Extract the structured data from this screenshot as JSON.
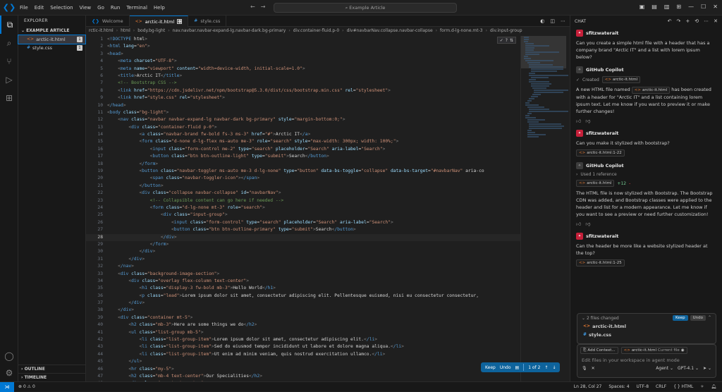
{
  "title": {
    "menu": [
      "File",
      "Edit",
      "Selection",
      "View",
      "Go",
      "Run",
      "Terminal",
      "Help"
    ],
    "search": "Example Article"
  },
  "explorer": {
    "header": "EXPLORER",
    "section": "EXAMPLE ARTICLE",
    "files": [
      {
        "name": "arctic-it.html",
        "badge": "1"
      },
      {
        "name": "style.css",
        "badge": "1"
      }
    ],
    "outline": "OUTLINE",
    "timeline": "TIMELINE"
  },
  "tabs": {
    "welcome": "Welcome",
    "arctic": "arctic-it.html",
    "style": "style.css"
  },
  "breadcrumb": [
    "rctic-it.html",
    "html",
    "body.bg-light",
    "nav.navbar.navbar-expand-lg.navbar-dark.bg-primary",
    "div.container-fluid.p-0",
    "div#navbarNav.collapse.navbar-collapse",
    "form.d-lg-none.mt-3",
    "div.input-group"
  ],
  "code": [
    {
      "n": "1",
      "t": "<!DOCTYPE html>"
    },
    {
      "n": "2",
      "t": "<html lang=\"en\">"
    },
    {
      "n": "3",
      "t": "<head>"
    },
    {
      "n": "4",
      "t": "    <meta charset=\"UTF-8\">"
    },
    {
      "n": "5",
      "t": "    <meta name=\"viewport\" content=\"width=device-width, initial-scale=1.0\">"
    },
    {
      "n": "6",
      "t": "    <title>Arctic IT</title>"
    },
    {
      "n": "7",
      "t": "    <!-- Bootstrap CSS -->"
    },
    {
      "n": "8",
      "t": "    <link href=\"https://cdn.jsdelivr.net/npm/bootstrap@5.3.0/dist/css/bootstrap.min.css\" rel=\"stylesheet\">"
    },
    {
      "n": "9",
      "t": "    <link href=\"style.css\" rel=\"stylesheet\">"
    },
    {
      "n": "10",
      "t": "</head>"
    },
    {
      "n": "11",
      "t": "<body class=\"bg-light\">"
    },
    {
      "n": "12",
      "t": "    <nav class=\"navbar navbar-expand-lg navbar-dark bg-primary\" style=\"margin-bottom:0;\">"
    },
    {
      "n": "13",
      "t": "        <div class=\"container-fluid p-0\">"
    },
    {
      "n": "14",
      "t": "            <a class=\"navbar-brand fw-bold fs-3 ms-3\" href=\"#\">Arctic IT</a>"
    },
    {
      "n": "15",
      "t": "            <form class=\"d-none d-lg-flex ms-auto me-3\" role=\"search\" style=\"max-width: 300px; width: 100%;\">"
    },
    {
      "n": "16",
      "t": "                <input class=\"form-control me-2\" type=\"search\" placeholder=\"Search\" aria-label=\"Search\">"
    },
    {
      "n": "17",
      "t": "                <button class=\"btn btn-outline-light\" type=\"submit\">Search</button>"
    },
    {
      "n": "18",
      "t": "            </form>"
    },
    {
      "n": "19",
      "t": "            <button class=\"navbar-toggler ms-auto me-3 d-lg-none\" type=\"button\" data-bs-toggle=\"collapse\" data-bs-target=\"#navbarNav\" aria-co"
    },
    {
      "n": "20",
      "t": "                <span class=\"navbar-toggler-icon\"></span>"
    },
    {
      "n": "21",
      "t": "            </button>"
    },
    {
      "n": "22",
      "t": "            <div class=\"collapse navbar-collapse\" id=\"navbarNav\">"
    },
    {
      "n": "23",
      "t": "                <!-- Collapsible content can go here if needed -->"
    },
    {
      "n": "24",
      "t": "                <form class=\"d-lg-none mt-3\" role=\"search\">"
    },
    {
      "n": "25",
      "t": "                    <div class=\"input-group\">"
    },
    {
      "n": "26",
      "t": "                        <input class=\"form-control\" type=\"search\" placeholder=\"Search\" aria-label=\"Search\">"
    },
    {
      "n": "27",
      "t": "                        <button class=\"btn btn-outline-primary\" type=\"submit\">Search</button>"
    },
    {
      "n": "28",
      "t": "                    </div>"
    },
    {
      "n": "29",
      "t": "                </form>"
    },
    {
      "n": "30",
      "t": "            </div>"
    },
    {
      "n": "31",
      "t": "        </div>"
    },
    {
      "n": "32",
      "t": "    </nav>"
    },
    {
      "n": "33",
      "t": "    <div class=\"background-image-section\">"
    },
    {
      "n": "34",
      "t": "        <div class=\"overlay flex-column text-center\">"
    },
    {
      "n": "35",
      "t": "            <h1 class=\"display-3 fw-bold mb-3\">Hello World</h1>"
    },
    {
      "n": "36",
      "t": "            <p class=\"lead\">Lorem ipsum dolor sit amet, consectetur adipiscing elit. Pellentesque euismod, nisi eu consectetur consectetur, "
    },
    {
      "n": "37",
      "t": "        </div>"
    },
    {
      "n": "38",
      "t": "    </div>"
    },
    {
      "n": "39",
      "t": "    <div class=\"container mt-5\">"
    },
    {
      "n": "40",
      "t": "        <h2 class=\"mb-3\">Here are some things we do</h2>"
    },
    {
      "n": "41",
      "t": "        <ul class=\"list-group mb-5\">"
    },
    {
      "n": "42",
      "t": "            <li class=\"list-group-item\">Lorem ipsum dolor sit amet, consectetur adipiscing elit.</li>"
    },
    {
      "n": "43",
      "t": "            <li class=\"list-group-item\">Sed do eiusmod tempor incididunt ut labore et dolore magna aliqua.</li>"
    },
    {
      "n": "44",
      "t": "            <li class=\"list-group-item\">Ut enim ad minim veniam, quis nostrud exercitation ullamco.</li>"
    },
    {
      "n": "45",
      "t": "        </ul>"
    },
    {
      "n": "46",
      "t": "        <hr class=\"my-5\">"
    },
    {
      "n": "47",
      "t": "        <h2 class=\"mb-4 text-center\">Our Specialities</h2>"
    },
    {
      "n": "48",
      "t": "        <div class=\"row text-center\">"
    }
  ],
  "editor_float": {
    "keep": "Keep",
    "undo": "Undo",
    "pager": "1 of 2"
  },
  "chat": {
    "title": "CHAT",
    "messages": [
      {
        "who": "sfitzwaterait",
        "text": "Can you create a simple html file with a header that has a company brand \"Arctic IT\" and a list with lorem ipsum below?"
      },
      {
        "who": "GitHub Copilot",
        "created": "Created",
        "chip": "arctic-it.html",
        "text1": "A new HTML file named",
        "chip2": "arctic-it.html",
        "text2": "has been created with a header for \"Arctic IT\" and a list containing lorem ipsum text. Let me know if you want to preview it or make further changes!"
      },
      {
        "who": "sfitzwaterait",
        "text": "Can you make it stylized with bootstrap?",
        "chip": "arctic-it.html:1-22"
      },
      {
        "who": "GitHub Copilot",
        "used": "Used 1 reference",
        "chip": "arctic-it.html",
        "plus": "+12",
        "minus": "-",
        "text": "The HTML file is now stylized with Bootstrap. The Bootstrap CDN was added, and Bootstrap classes were applied to the header and list for a modern appearance. Let me know if you want to see a preview or need further customization!"
      },
      {
        "who": "sfitzwaterait",
        "text": "Can the header be more like a website stylized header at the top?",
        "chip": "arctic-it.html:1-25"
      }
    ],
    "changes": {
      "label": "2 files changed",
      "keep": "Keep",
      "undo": "Undo",
      "files": [
        "arctic-it.html",
        "style.css"
      ]
    },
    "input": {
      "add_context": "Add Context...",
      "context_file": "arctic-it.html",
      "context_note": "Current file",
      "placeholder": "Edit files in your workspace in agent mode",
      "mode": "Agent",
      "model": "GPT-4.1"
    }
  },
  "status": {
    "errors": "0",
    "warnings": "0",
    "position": "Ln 28, Col 27",
    "spaces": "Spaces: 4",
    "encoding": "UTF-8",
    "eol": "CRLF",
    "lang": "HTML",
    "notif_count": "1"
  },
  "colors": {
    "accent": "#0078d4",
    "user_avatar": "#c6203a"
  }
}
